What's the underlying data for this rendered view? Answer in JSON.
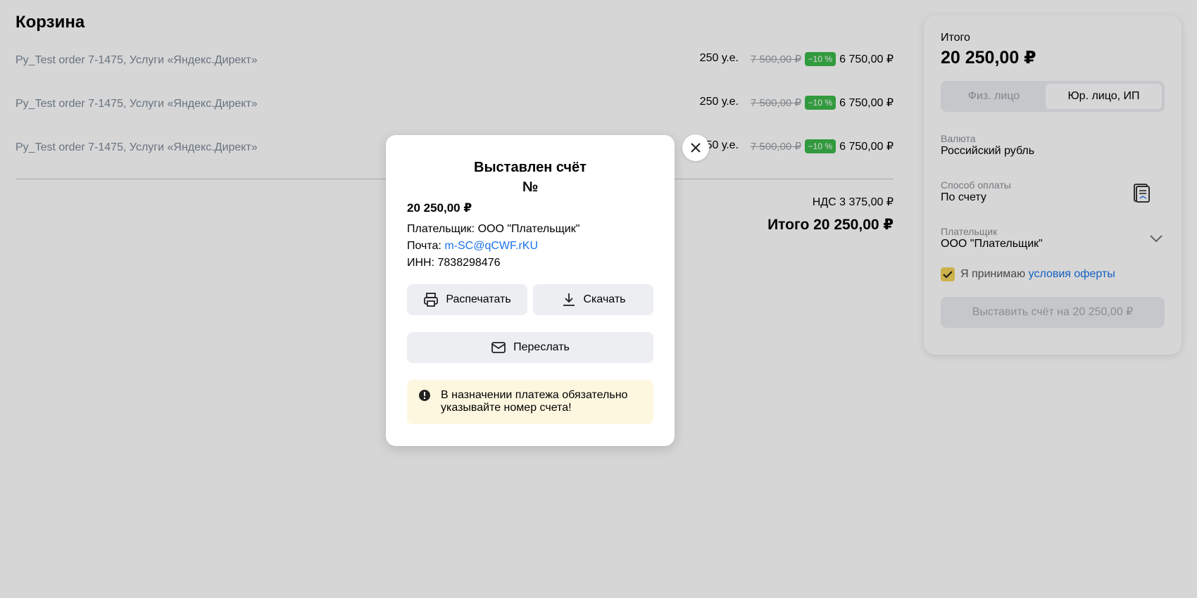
{
  "page": {
    "title": "Корзина"
  },
  "cart": {
    "items": [
      {
        "name": "Py_Test order 7-1475, Услуги «Яндекс.Директ»",
        "qty": "250 у.е.",
        "old_price": "7 500,00 ₽",
        "discount": "−10 %",
        "price": "6 750,00 ₽"
      },
      {
        "name": "Py_Test order 7-1475, Услуги «Яндекс.Директ»",
        "qty": "250 у.е.",
        "old_price": "7 500,00 ₽",
        "discount": "−10 %",
        "price": "6 750,00 ₽"
      },
      {
        "name": "Py_Test order 7-1475, Услуги «Яндекс.Директ»",
        "qty": "250 у.е.",
        "old_price": "7 500,00 ₽",
        "discount": "−10 %",
        "price": "6 750,00 ₽"
      }
    ],
    "vat": "НДС 3 375,00 ₽",
    "total": "Итого 20 250,00 ₽"
  },
  "side": {
    "total_label": "Итого",
    "total_value": "20 250,00 ₽",
    "seg_individual": "Физ. лицо",
    "seg_legal": "Юр. лицо, ИП",
    "currency_label": "Валюта",
    "currency_value": "Российский рубль",
    "payment_label": "Способ оплаты",
    "payment_value": "По счету",
    "payer_label": "Плательщик",
    "payer_value": "ООО \"Плательщик\"",
    "accept_text": "Я принимаю",
    "accept_link": "условия оферты",
    "issue_button": "Выставить счёт на 20 250,00 ₽"
  },
  "modal": {
    "title_line1": "Выставлен счёт",
    "title_line2": "№",
    "amount": "20 250,00 ₽",
    "payer": "Плательщик: ООО \"Плательщик\"",
    "email_label": "Почта:",
    "email_value": "m-SC@qCWF.rKU",
    "inn": "ИНН: 7838298476",
    "print_button": "Распечатать",
    "download_button": "Скачать",
    "forward_button": "Переслать",
    "warning": "В назначении платежа обязательно указывайте номер счета!"
  },
  "colors": {
    "discount_badge": "#3cb84a",
    "link": "#1a73e8",
    "checkbox": "#f5d45a",
    "warning_bg": "#fef7e0"
  }
}
